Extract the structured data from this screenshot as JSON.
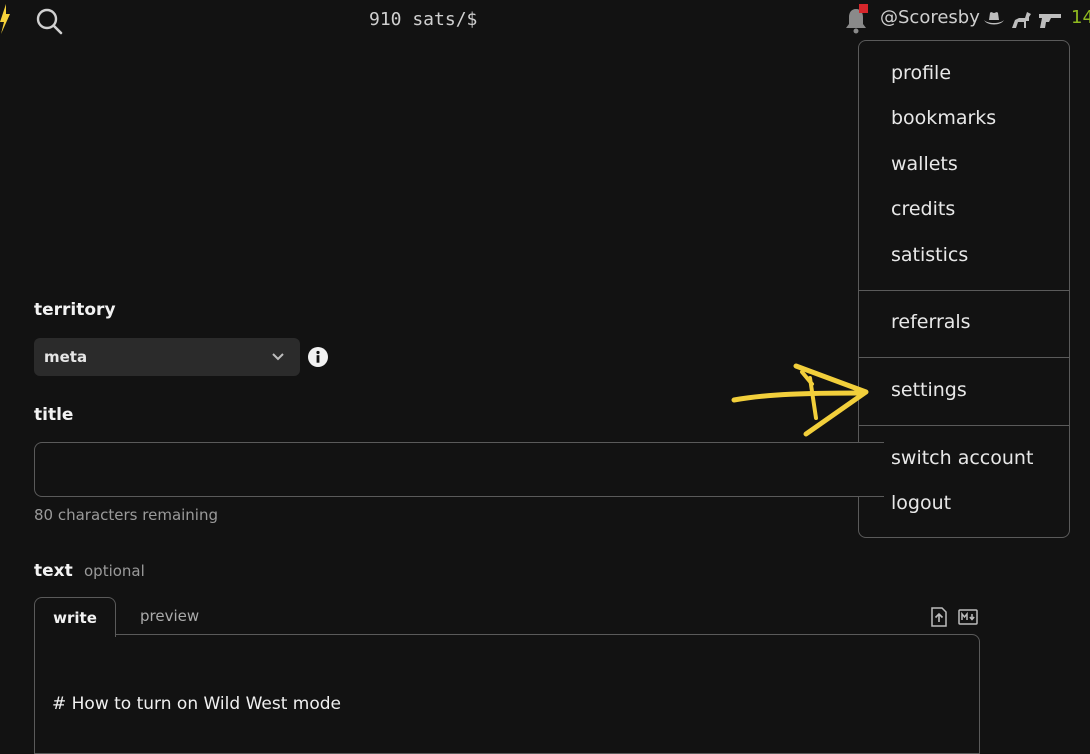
{
  "header": {
    "price": "910 sats/$",
    "username": "@Scoresby",
    "sats": "14",
    "icons": [
      "lightning-logo-icon",
      "search-icon",
      "bell-icon",
      "cowboy-hat-icon",
      "horse-icon",
      "revolver-icon"
    ],
    "notification_color": "#d6262b"
  },
  "menu": {
    "items": [
      "profile",
      "bookmarks",
      "wallets",
      "credits",
      "satistics",
      "referrals",
      "settings",
      "switch account",
      "logout"
    ]
  },
  "form": {
    "territory_label": "territory",
    "territory_value": "meta",
    "title_label": "title",
    "title_value": "",
    "chars_remaining": "80 characters remaining",
    "text_label": "text",
    "text_optional": "optional",
    "tab_write": "write",
    "tab_preview": "preview",
    "editor_text": "# How to turn on Wild West mode"
  },
  "annotation": {
    "arrow_color": "#f2cf3b"
  }
}
